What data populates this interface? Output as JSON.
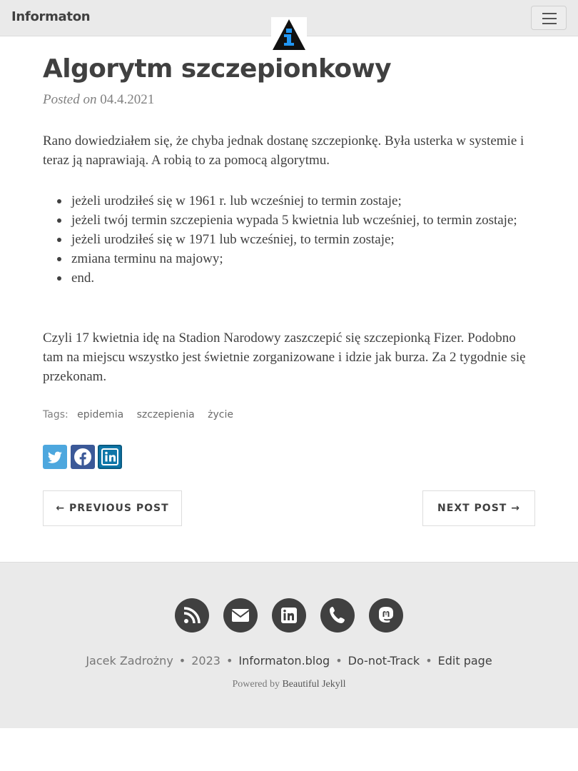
{
  "nav": {
    "brand": "Informaton"
  },
  "post": {
    "title": "Algorytm szczepionkowy",
    "posted_label": "Posted on",
    "date": "04.4.2021",
    "intro": "Rano dowiedziałem się, że chyba jednak dostanę szczepionkę. Była usterka w systemie i teraz ją naprawiają. A robią to za pomocą algorytmu.",
    "list": [
      "jeżeli urodziłeś się w 1961 r. lub wcześniej to termin zostaje;",
      "jeżeli twój termin szczepienia wypada 5 kwietnia lub wcześniej, to termin zostaje;",
      "jeżeli urodziłeś się w 1971 lub wcześniej, to termin zostaje;",
      "zmiana terminu na majowy;",
      "end."
    ],
    "outro": "Czyli 17 kwietnia idę na Stadion Narodowy zaszczepić się szczepionką Fizer. Podobno tam na miejscu wszystko jest świetnie zorganizowane i idzie jak burza. Za 2 tygodnie się przekonam."
  },
  "tags": {
    "label": "Tags:",
    "items": [
      "epidemia",
      "szczepienia",
      "życie"
    ]
  },
  "share": {
    "icons": [
      "twitter-icon",
      "facebook-icon",
      "linkedin-icon"
    ],
    "colors": [
      "#4da7de",
      "#3b5998",
      "#0e76a8"
    ]
  },
  "pager": {
    "previous": "← PREVIOUS POST",
    "next": "NEXT POST →"
  },
  "footer": {
    "icons": [
      "rss-icon",
      "envelope-icon",
      "linkedin-icon",
      "phone-icon",
      "mastodon-icon"
    ],
    "author": "Jacek Zadrożny",
    "year": "2023",
    "site": "Informaton.blog",
    "dnt": "Do-not-Track",
    "edit": "Edit page",
    "powered_by": "Powered by",
    "theme": "Beautiful Jekyll"
  }
}
